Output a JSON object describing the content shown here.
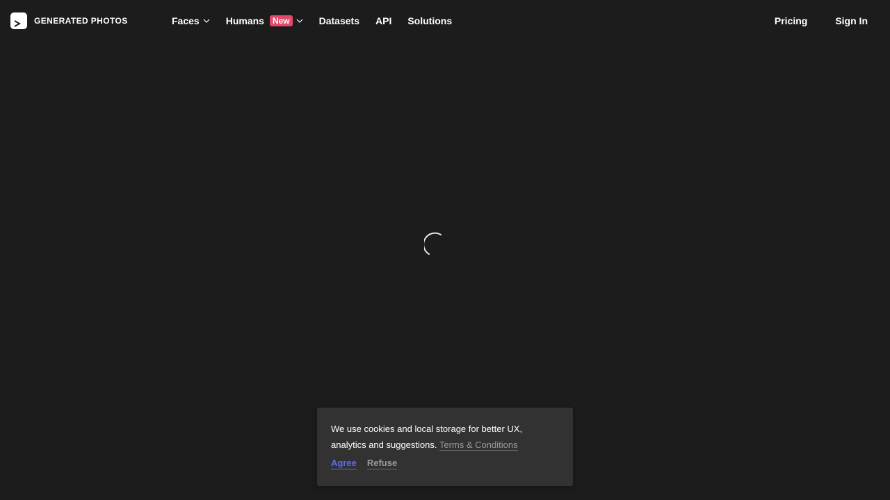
{
  "brand": {
    "name": "GENERATED PHOTOS",
    "logo_icon": "play-chevron-icon"
  },
  "nav": {
    "faces": "Faces",
    "humans": "Humans",
    "humans_badge": "New",
    "datasets": "Datasets",
    "api": "API",
    "solutions": "Solutions",
    "pricing": "Pricing",
    "sign_in": "Sign In"
  },
  "loading": {
    "icon": "loading-spinner-icon"
  },
  "cookie_banner": {
    "message": "We use cookies and local storage for better UX, analytics and suggestions.",
    "terms_link": "Terms & Conditions",
    "agree": "Agree",
    "refuse": "Refuse"
  },
  "colors": {
    "background": "#1c1c1c",
    "banner_background": "#323232",
    "badge": "#e5486b",
    "agree": "#5b6cf0"
  }
}
